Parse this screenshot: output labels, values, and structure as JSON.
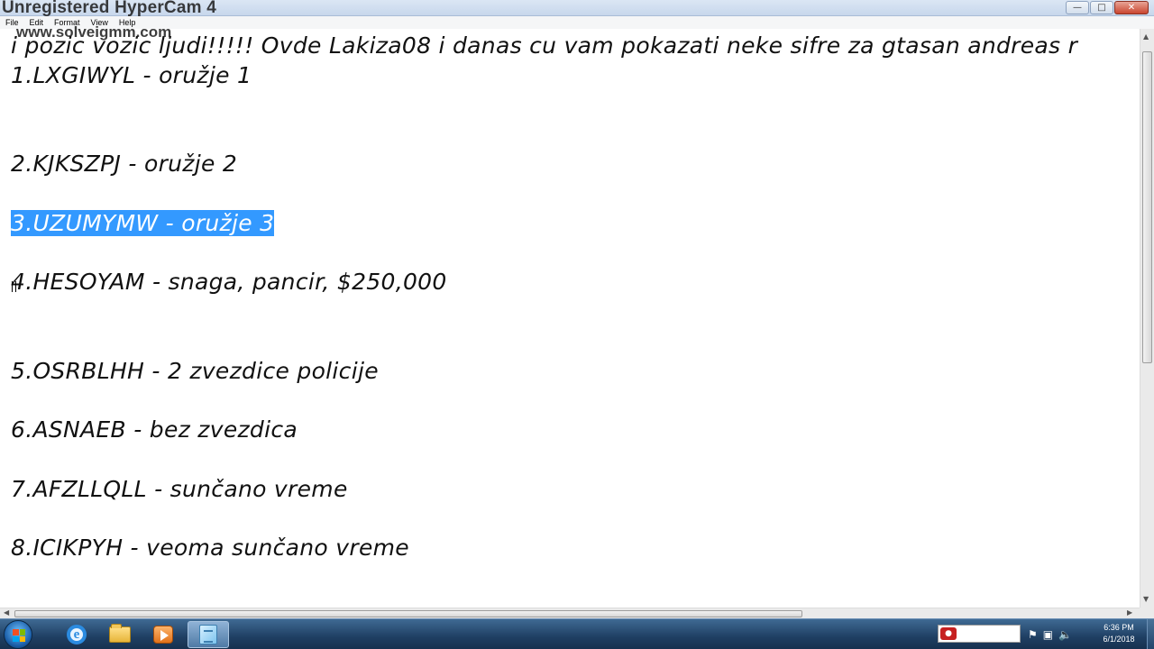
{
  "watermark": {
    "title": "Unregistered HyperCam 4",
    "url": "www.solveigmm.com"
  },
  "window": {
    "controls": {
      "minimize": "—",
      "maximize": "□",
      "close": "✕"
    }
  },
  "menu": [
    "File",
    "Edit",
    "Format",
    "View",
    "Help"
  ],
  "document": {
    "lines": [
      "i pozic vozic ljudi!!!!! Ovde Lakiza08 i danas cu vam pokazati neke sifre za gtasan andreas r",
      "1.LXGIWYL - oružje 1",
      "2.KJKSZPJ - oružje 2",
      "3.UZUMYMW - oružje 3",
      "4.HESOYAM - snaga, pancir, $250,000",
      "5.OSRBLHH - 2 zvezdice policije",
      "6.ASNAEB - bez zvezdica",
      "7.AFZLLQLL - sunčano vreme",
      "8.ICIKPYH - veoma sunčano vreme"
    ],
    "selected_line_index": 3
  },
  "taskbar": {
    "apps": [
      {
        "name": "internet-explorer-icon",
        "active": false
      },
      {
        "name": "file-explorer-icon",
        "active": false
      },
      {
        "name": "media-player-icon",
        "active": false
      },
      {
        "name": "notepad-icon",
        "active": true
      }
    ],
    "tray": {
      "record_icon": "rec",
      "icons": [
        "flag-icon",
        "network-icon",
        "volume-icon"
      ]
    },
    "clock": {
      "time": "6:36 PM",
      "date": "6/1/2018"
    }
  }
}
